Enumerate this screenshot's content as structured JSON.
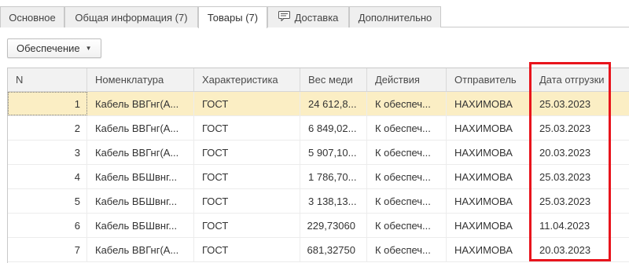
{
  "tabs": [
    {
      "label": "Основное"
    },
    {
      "label": "Общая информация (7)"
    },
    {
      "label": "Товары (7)"
    },
    {
      "label": "Доставка"
    },
    {
      "label": "Дополнительно"
    }
  ],
  "toolbar": {
    "supply_button_label": "Обеспечение"
  },
  "table": {
    "headers": [
      "N",
      "Номенклатура",
      "Характеристика",
      "Вес меди",
      "Действия",
      "Отправитель",
      "Дата отгрузки"
    ],
    "rows": [
      {
        "n": "1",
        "item": "Кабель ВВГнг(А...",
        "char": "ГОСТ",
        "weight": "24 612,8...",
        "action": "К обеспеч...",
        "sender": "НАХИМОВА",
        "date": "25.03.2023"
      },
      {
        "n": "2",
        "item": "Кабель ВВГнг(А...",
        "char": "ГОСТ",
        "weight": "6 849,02...",
        "action": "К обеспеч...",
        "sender": "НАХИМОВА",
        "date": "25.03.2023"
      },
      {
        "n": "3",
        "item": "Кабель ВВГнг(А...",
        "char": "ГОСТ",
        "weight": "5 907,10...",
        "action": "К обеспеч...",
        "sender": "НАХИМОВА",
        "date": "20.03.2023"
      },
      {
        "n": "4",
        "item": "Кабель ВБШвнг...",
        "char": "ГОСТ",
        "weight": "1 786,70...",
        "action": "К обеспеч...",
        "sender": "НАХИМОВА",
        "date": "25.03.2023"
      },
      {
        "n": "5",
        "item": "Кабель ВБШвнг...",
        "char": "ГОСТ",
        "weight": "3 138,13...",
        "action": "К обеспеч...",
        "sender": "НАХИМОВА",
        "date": "25.03.2023"
      },
      {
        "n": "6",
        "item": "Кабель ВБШвнг...",
        "char": "ГОСТ",
        "weight": "229,73060",
        "action": "К обеспеч...",
        "sender": "НАХИМОВА",
        "date": "11.04.2023"
      },
      {
        "n": "7",
        "item": "Кабель ВВГнг(А...",
        "char": "ГОСТ",
        "weight": "681,32750",
        "action": "К обеспеч...",
        "sender": "НАХИМОВА",
        "date": "20.03.2023"
      }
    ]
  },
  "colors": {
    "selected_row": "#fbeec4",
    "highlight_border": "#e8141c"
  }
}
